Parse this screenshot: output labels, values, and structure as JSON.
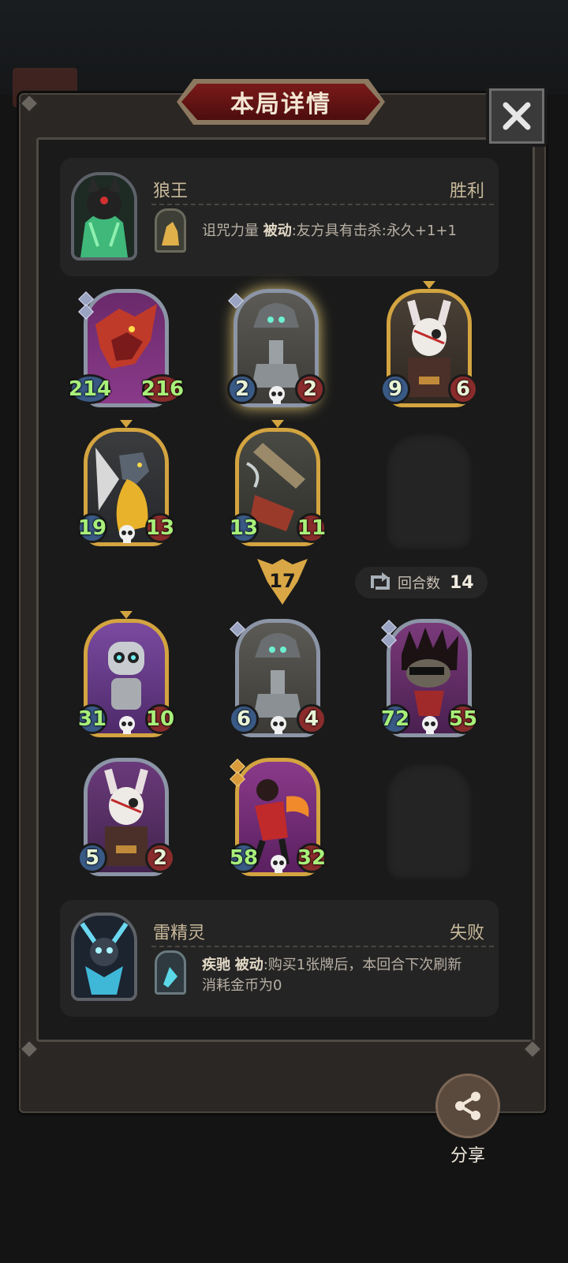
{
  "dialog": {
    "title": "本局详情",
    "close_symbol": "✕"
  },
  "top_hero": {
    "name": "狼王",
    "result": "胜利",
    "skill_name": "诅咒力量",
    "skill_type": "被动",
    "skill_desc": ":友方具有击杀:永久+1+1"
  },
  "top_board": [
    {
      "attack": "214",
      "health": "216",
      "frame": "silver",
      "atk_color": "green",
      "hp_color": "green",
      "gems": 2,
      "art": "red-dragon"
    },
    {
      "attack": "2",
      "health": "2",
      "frame": "silver",
      "atk_color": "white",
      "hp_color": "white",
      "gems": 1,
      "art": "bell-robot"
    },
    {
      "attack": "9",
      "health": "6",
      "frame": "gold",
      "atk_color": "white",
      "hp_color": "white",
      "gems": 0,
      "art": "masked-rabbit"
    },
    {
      "attack": "19",
      "health": "13",
      "frame": "gold",
      "atk_color": "green",
      "hp_color": "green",
      "gems": 0,
      "art": "gold-dragon"
    },
    {
      "attack": "13",
      "health": "11",
      "frame": "gold",
      "atk_color": "green",
      "hp_color": "green",
      "gems": 0,
      "art": "rocket"
    }
  ],
  "damage": "17",
  "rounds": {
    "label": "回合数",
    "value": "14"
  },
  "bottom_board": [
    {
      "attack": "31",
      "health": "10",
      "frame": "gold",
      "atk_color": "green",
      "hp_color": "green",
      "gems": 0,
      "art": "robot"
    },
    {
      "attack": "6",
      "health": "4",
      "frame": "silver",
      "atk_color": "white",
      "hp_color": "white",
      "gems": 1,
      "art": "bell-robot"
    },
    {
      "attack": "72",
      "health": "55",
      "frame": "silver",
      "atk_color": "green",
      "hp_color": "green",
      "gems": 2,
      "art": "hedgehog"
    },
    {
      "attack": "5",
      "health": "2",
      "frame": "silver",
      "atk_color": "white",
      "hp_color": "white",
      "gems": 0,
      "art": "masked-rabbit"
    },
    {
      "attack": "58",
      "health": "32",
      "frame": "gold",
      "atk_color": "green",
      "hp_color": "green",
      "gems": 2,
      "art": "fire-ninja"
    }
  ],
  "bottom_hero": {
    "name": "雷精灵",
    "result": "失败",
    "skill_name": "疾驰",
    "skill_type": "被动",
    "skill_desc_line1": ":购买1张牌后，本回合下次刷新",
    "skill_desc_line2": "消耗金币为0"
  },
  "share": {
    "label": "分享"
  }
}
